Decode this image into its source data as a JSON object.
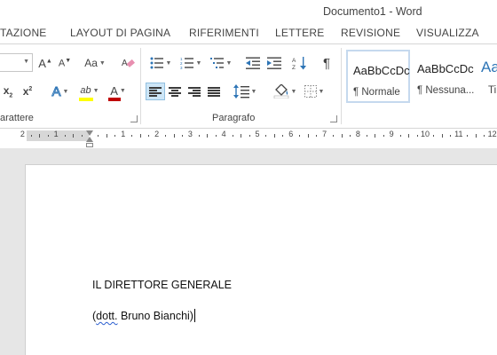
{
  "window": {
    "title": "Documento1 - Word"
  },
  "tabs": [
    "TAZIONE",
    "LAYOUT DI PAGINA",
    "RIFERIMENTI",
    "LETTERE",
    "REVISIONE",
    "VISUALIZZA"
  ],
  "ribbon": {
    "font_group_label": "arattere",
    "paragraph_group_label": "Paragrafo",
    "font": {
      "grow_glyph": "A",
      "shrink_glyph": "A",
      "case_glyph": "Aa",
      "subscript_glyph": "x",
      "superscript_glyph": "x",
      "text_effects_glyph": "A",
      "highlight_glyph": "ab",
      "font_color_glyph": "A",
      "highlight_color": "#ffff00",
      "font_color": "#c00000",
      "text_effects_color": "#2e75b6"
    },
    "paragraph": {
      "show_marks_glyph": "¶"
    },
    "styles": [
      {
        "sample": "AaBbCcDc",
        "name": "¶ Normale",
        "selected": true
      },
      {
        "sample": "AaBbCcDc",
        "name": "¶ Nessuna...",
        "selected": false
      },
      {
        "sample": "Aa",
        "name": "Ti",
        "selected": false
      }
    ]
  },
  "ruler": {
    "numbers": [
      "2",
      "1",
      "1",
      "2",
      "3",
      "4",
      "5",
      "6",
      "7",
      "8",
      "9",
      "10",
      "11",
      "12"
    ]
  },
  "document": {
    "line1": "IL DIRETTORE GENERALE",
    "line2_open": "(",
    "line2_misspelled": "dott.",
    "line2_rest": " Bruno Bianchi)"
  }
}
